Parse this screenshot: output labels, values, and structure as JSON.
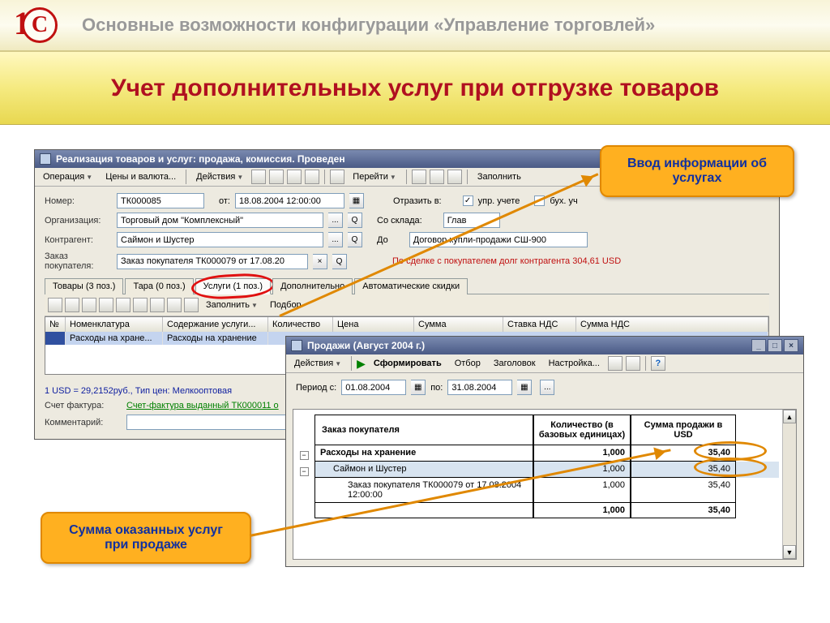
{
  "slide": {
    "header_title": "Основные возможности конфигурации «Управление торговлей»",
    "title": "Учет дополнительных услуг при отгрузке товаров",
    "logo_c": "С",
    "logo_1": "1"
  },
  "win1": {
    "title": "Реализация товаров и услуг: продажа, комиссия. Проведен",
    "menu": {
      "op": "Операция",
      "prices": "Цены и валюта...",
      "actions": "Действия",
      "goto": "Перейти",
      "fill": "Заполнить"
    },
    "fields": {
      "number_label": "Номер:",
      "number": "ТК000085",
      "from_label": "от:",
      "date": "18.08.2004 12:00:00",
      "reflect_label": "Отразить в:",
      "check_upr": "упр. учете",
      "check_buh": "бух. уч",
      "org_label": "Организация:",
      "org": "Торговый дом \"Комплексный\"",
      "from_ware_label": "Со склада:",
      "from_ware": "Глав",
      "contragent_label": "Контрагент:",
      "contragent": "Саймон и Шустер",
      "contract_label": "До",
      "contract": "Договор купли-продажи СШ-900",
      "order_label": "Заказ покупателя:",
      "order": "Заказ покупателя ТК000079 от 17.08.20",
      "debt_text": "По сделке с покупателем долг контрагента 304,61 USD"
    },
    "tabs": [
      "Товары (3 поз.)",
      "Тара (0 поз.)",
      "Услуги (1 поз.)",
      "Дополнительно",
      "Автоматические скидки"
    ],
    "grid_tb": {
      "fill": "Заполнить",
      "select": "Подбор"
    },
    "grid": {
      "headers": [
        "№",
        "Номенклатура",
        "Содержание услуги...",
        "Количество",
        "Цена",
        "Сумма",
        "Ставка НДС",
        "Сумма НДС"
      ],
      "row": [
        "",
        "Расходы на хране...",
        "Расходы на хранение"
      ]
    },
    "footer": {
      "rate": "1 USD = 29,2152руб., Тип цен: Мелкооптовая",
      "invoice_label": "Счет фактура:",
      "invoice": "Счет-фактура выданный ТК000011 о",
      "comment_label": "Комментарий:"
    }
  },
  "win2": {
    "title": "Продажи (Август 2004 г.)",
    "menu": {
      "actions": "Действия",
      "form": "Сформировать",
      "filter": "Отбор",
      "header": "Заголовок",
      "settings": "Настройка..."
    },
    "period": {
      "label": "Период с:",
      "from": "01.08.2004",
      "to_label": "по:",
      "to": "31.08.2004"
    },
    "table": {
      "h1": "Заказ покупателя",
      "h2": "Количество (в базовых единицах)",
      "h3": "Сумма продажи в USD",
      "rows": [
        {
          "label": "Расходы на хранение",
          "qty": "1,000",
          "sum": "35,40",
          "bold": true,
          "indent": 0
        },
        {
          "label": "Саймон и Шустер",
          "qty": "1,000",
          "sum": "35,40",
          "indent": 1,
          "hl": true
        },
        {
          "label": "Заказ покупателя ТК000079 от 17.08.2004 12:00:00",
          "qty": "1,000",
          "sum": "35,40",
          "indent": 2
        }
      ],
      "total": {
        "label": "",
        "qty": "1,000",
        "sum": "35,40"
      }
    }
  },
  "callouts": {
    "c1": "Ввод информации об услугах",
    "c2": "Сумма оказанных услуг при продаже"
  }
}
